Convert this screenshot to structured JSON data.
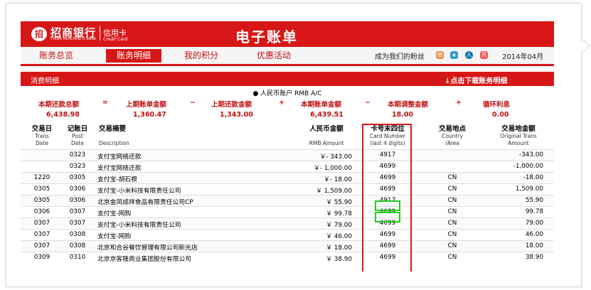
{
  "bank": {
    "name_cn": "招商银行",
    "name_en": "CHINA MERCHANTS BANK",
    "logo": "招",
    "card_cn": "信用卡",
    "card_en": "Credit Card"
  },
  "title": "电子账单",
  "nav": {
    "tabs": [
      "账务总览",
      "账务明细",
      "我的积分",
      "优惠活动"
    ],
    "active": 1,
    "fans_text": "成为我们的粉丝",
    "month": "2014年04月",
    "social_icons": [
      "weibo-icon",
      "star-icon",
      "renren-icon",
      "kaixin-icon"
    ]
  },
  "section": {
    "title": "消费明细",
    "download": "↓点击下载账务明细"
  },
  "account": "● 人民币账户 RMB A/C",
  "summary": {
    "labels": [
      "本期还款总额",
      "=",
      "上期账单金额",
      "−",
      "上期还款金额",
      "+",
      "本期账单金额",
      "−",
      "本期调整金额",
      "+",
      "循环利息"
    ],
    "values": [
      "6,438.98",
      "1,360.47",
      "1,343.00",
      "6,439.51",
      "18.00",
      "0.00"
    ]
  },
  "columns": {
    "trans_date": {
      "cn": "交易日",
      "en1": "Trans",
      "en2": "Date"
    },
    "post_date": {
      "cn": "记账日",
      "en1": "Post",
      "en2": "Date"
    },
    "desc": {
      "cn": "交易摘要",
      "en": "Description"
    },
    "rmb": {
      "cn": "人民币金额",
      "en": "RMB Amount"
    },
    "card": {
      "cn": "卡号末四位",
      "en1": "Card Number",
      "en2": "(last 4 digits)"
    },
    "country": {
      "cn": "交易地点",
      "en1": "Country",
      "en2": "/Area"
    },
    "orig": {
      "cn": "交易地金额",
      "en1": "Original Trans",
      "en2": "Amount"
    }
  },
  "rows": [
    {
      "trans": "",
      "post": "0323",
      "desc": "支付宝网络还款",
      "rmb": "￥- 343.00",
      "card": "4917",
      "country": "",
      "orig": "-343.00"
    },
    {
      "trans": "",
      "post": "0323",
      "desc": "支付宝网络还款",
      "rmb": "￥- 1,000.00",
      "card": "4699",
      "country": "",
      "orig": "-1,000.00"
    },
    {
      "trans": "1220",
      "post": "0305",
      "desc": "支付宝-胡石根",
      "rmb": "￥- 18.00",
      "card": "4699",
      "country": "CN",
      "orig": "-18.00"
    },
    {
      "trans": "0305",
      "post": "0306",
      "desc": "支付宝-小米科技有限责任公司",
      "rmb": "￥ 1,509.00",
      "card": "4699",
      "country": "CN",
      "orig": "1,509.00"
    },
    {
      "trans": "0305",
      "post": "0306",
      "desc": "北京金凤成祥食品有限责任公司CP",
      "rmb": "￥ 55.90",
      "card": "4917",
      "country": "CN",
      "orig": "55.90"
    },
    {
      "trans": "0306",
      "post": "0307",
      "desc": "支付宝-网购",
      "rmb": "￥ 99.78",
      "card": "4699",
      "country": "CN",
      "orig": "99.78"
    },
    {
      "trans": "0307",
      "post": "0307",
      "desc": "支付宝-小米科技有限责任公司",
      "rmb": "￥ 79.00",
      "card": "4699",
      "country": "CN",
      "orig": "79.00"
    },
    {
      "trans": "0307",
      "post": "0308",
      "desc": "支付宝-网购",
      "rmb": "￥ 46.00",
      "card": "4699",
      "country": "CN",
      "orig": "46.00"
    },
    {
      "trans": "0307",
      "post": "0308",
      "desc": "北京和合谷餐饮管理有限公司新光店",
      "rmb": "￥ 18.00",
      "card": "4699",
      "country": "CN",
      "orig": "18.00"
    },
    {
      "trans": "0309",
      "post": "0310",
      "desc": "北京京客隆商业集团股份有限公司",
      "rmb": "￥ 38.90",
      "card": "4699",
      "country": "CN",
      "orig": "38.90"
    }
  ]
}
